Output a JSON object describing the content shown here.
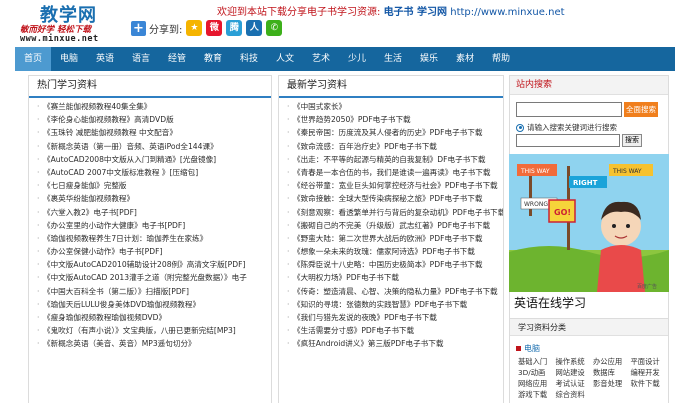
{
  "header": {
    "logo_text": "教学网",
    "slogan": "敏而好学  轻松下载",
    "url": "www.minxue.net",
    "share_label": "分享到:",
    "banner_text": "欢迎到本站下载分享电子书学习资源: ",
    "banner_bold": "电子书 学习网",
    "banner_url": " http://www.minxue.net"
  },
  "share_icons": [
    {
      "name": "qzone-icon",
      "color": "#f5b400",
      "glyph": "★"
    },
    {
      "name": "weibo-icon",
      "color": "#e6162d",
      "glyph": "微"
    },
    {
      "name": "tqq-icon",
      "color": "#2a9fd6",
      "glyph": "腾"
    },
    {
      "name": "renren-icon",
      "color": "#1a6fb0",
      "glyph": "人"
    },
    {
      "name": "wechat-icon",
      "color": "#3db01a",
      "glyph": "✆"
    }
  ],
  "nav": [
    "首页",
    "电脑",
    "英语",
    "语言",
    "经管",
    "教育",
    "科技",
    "人文",
    "艺术",
    "少儿",
    "生活",
    "娱乐",
    "素材",
    "帮助"
  ],
  "hot": {
    "title": "热门学习资料",
    "items": [
      "《赛兰能伽视频教程40集全集》",
      "《李伦身心能伽视频教程》高清DVD版",
      "《玉珠铃 减肥能伽视频教程 中文配音》",
      "《新概念英语（第一册）音频、英语iPod全144课》",
      "《AutoCAD2008中文版从入门到精通》[光盘镜像]",
      "《AutoCAD 2007中文版标准教程 》[压缩包]",
      "《七日瘦身能伽》完整版",
      "《裹英华纷能伽视频教程》",
      "《六堂入教2》电子书[PDF]",
      "《办公室里的小动作大健康》电子书[PDF]",
      "《瑜伽视频教程养生7日计划：瑜伽养生在家练》",
      "《办公室保健小动作》电子书[PDF]",
      "《中文版AutoCAD2010辅助设计208例》高清文字版[PDF]",
      "《中文版AutoCAD 2013灌手之道（附完整光盘数据）》电子",
      "《中国大百科全书（第二版）》扫描版[PDF]",
      "《瑜伽天后LULU俊身美体DVD瑜伽视频教程》",
      "《瘦身瑜伽视频教程瑜伽视频DVD》",
      "《鬼吹灯（有声小说）》文宝典版，八册已更新完结[MP3]",
      "《新概念英语（美音、英音）MP3遥句切分》"
    ]
  },
  "latest": {
    "title": "最新学习资料",
    "items": [
      "《中国式家长》",
      "《世界趋势2050》PDF电子书下载",
      "《秦民帝国：历度流及其人侵者的历史》PDF电子书下载",
      "《致命流感：百年治疗史》PDF电子书下载",
      "《出走：不平等的起源与精英的自我复制》DF电子书下载",
      "《青春是一本合伍的书，我们是谁读一遍再读》电子书下载",
      "《经谷带童：宽业巨头如何掌控经济与社会》PDF电子书下载",
      "《致命接触：全球大型传染病探秘之旅》PDF电子书下载",
      "《刻意观察：看透繁单并行与背后的复杂动机》PDF电子书下载",
      "《搬砌自己的不完美（升级版）武志红著》PDF电子书下载",
      "《野蛮大陆：第二次世界大战后的欧洲》PDF电子书下载",
      "《想象一朵未来的玫瑰：儒家阿诗选》PDF电子书下载",
      "《陈舜臣说十八史略：中国历史极简本》PDF电子书下载",
      "《大明权力场》PDF电子书下载",
      "《传奇：塑造清晨、心智、决策的隐私力量》PDF电子书下载",
      "《知识的寻境：张德数的实践智慧》PDF电子书下载",
      "《我们与猎先发说的夜晚》PDF电子书下载",
      "《生活需要分寸感》PDF电子书下载",
      "《疯狂Android讲义》第三版PDF电子书下载"
    ]
  },
  "sidebar": {
    "search_title": "站内搜索",
    "search_button": "全面搜索",
    "radio_label": "请输入搜索关键词进行搜索",
    "keyword_button": "搜索",
    "ad_caption": "英语在线学习",
    "category_title": "学习资料分类",
    "category_head": "电脑",
    "category_items": [
      "基础入门",
      "操作系统",
      "办公应用",
      "平面设计",
      "3D/动画",
      "网站建设",
      "数据库",
      "编程开发",
      "网络应用",
      "考试认证",
      "影音处理",
      "软件下载",
      "游戏下载",
      "综合资料"
    ]
  },
  "ad_signs": {
    "wrong": "WRONG",
    "right": "RIGHT",
    "this_way_1": "THIS WAY",
    "this_way_2": "THIS WAY",
    "go": "GO!",
    "corner": "百度广告"
  }
}
